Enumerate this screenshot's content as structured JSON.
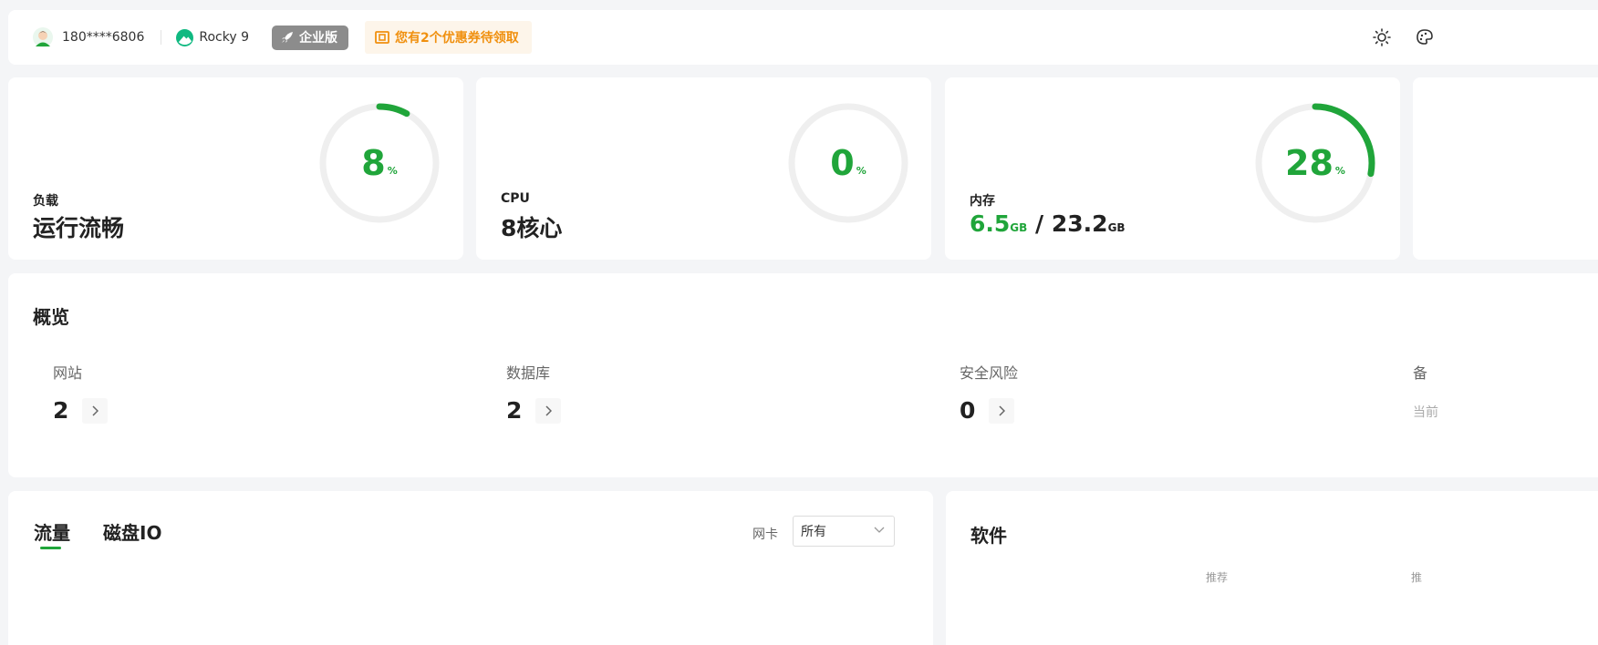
{
  "header": {
    "username": "180****6806",
    "os_name": "Rocky 9",
    "edition_label": "企业版",
    "coupon_text": "您有2个优惠券待领取"
  },
  "stats": {
    "load": {
      "label": "负载",
      "status": "运行流畅",
      "percent": 8,
      "percent_unit": "%"
    },
    "cpu": {
      "label": "CPU",
      "cores": "8核心",
      "percent": 0,
      "percent_unit": "%"
    },
    "memory": {
      "label": "内存",
      "used": "6.5",
      "used_unit": "GB",
      "separator": "/",
      "total": "23.2",
      "total_unit": "GB",
      "percent": 28,
      "percent_unit": "%"
    }
  },
  "overview": {
    "title": "概览",
    "items": [
      {
        "label": "网站",
        "count": "2"
      },
      {
        "label": "数据库",
        "count": "2"
      },
      {
        "label": "安全风险",
        "count": "0"
      },
      {
        "label": "备",
        "sub": "当前"
      }
    ]
  },
  "traffic": {
    "tabs": [
      "流量",
      "磁盘IO"
    ],
    "nic_label": "网卡",
    "nic_value": "所有"
  },
  "software": {
    "title": "软件",
    "cut_labels": [
      "推荐",
      "推"
    ]
  },
  "colors": {
    "accent": "#20a53a",
    "coupon": "#f0900f",
    "edition_bg": "#8c8c8c"
  }
}
